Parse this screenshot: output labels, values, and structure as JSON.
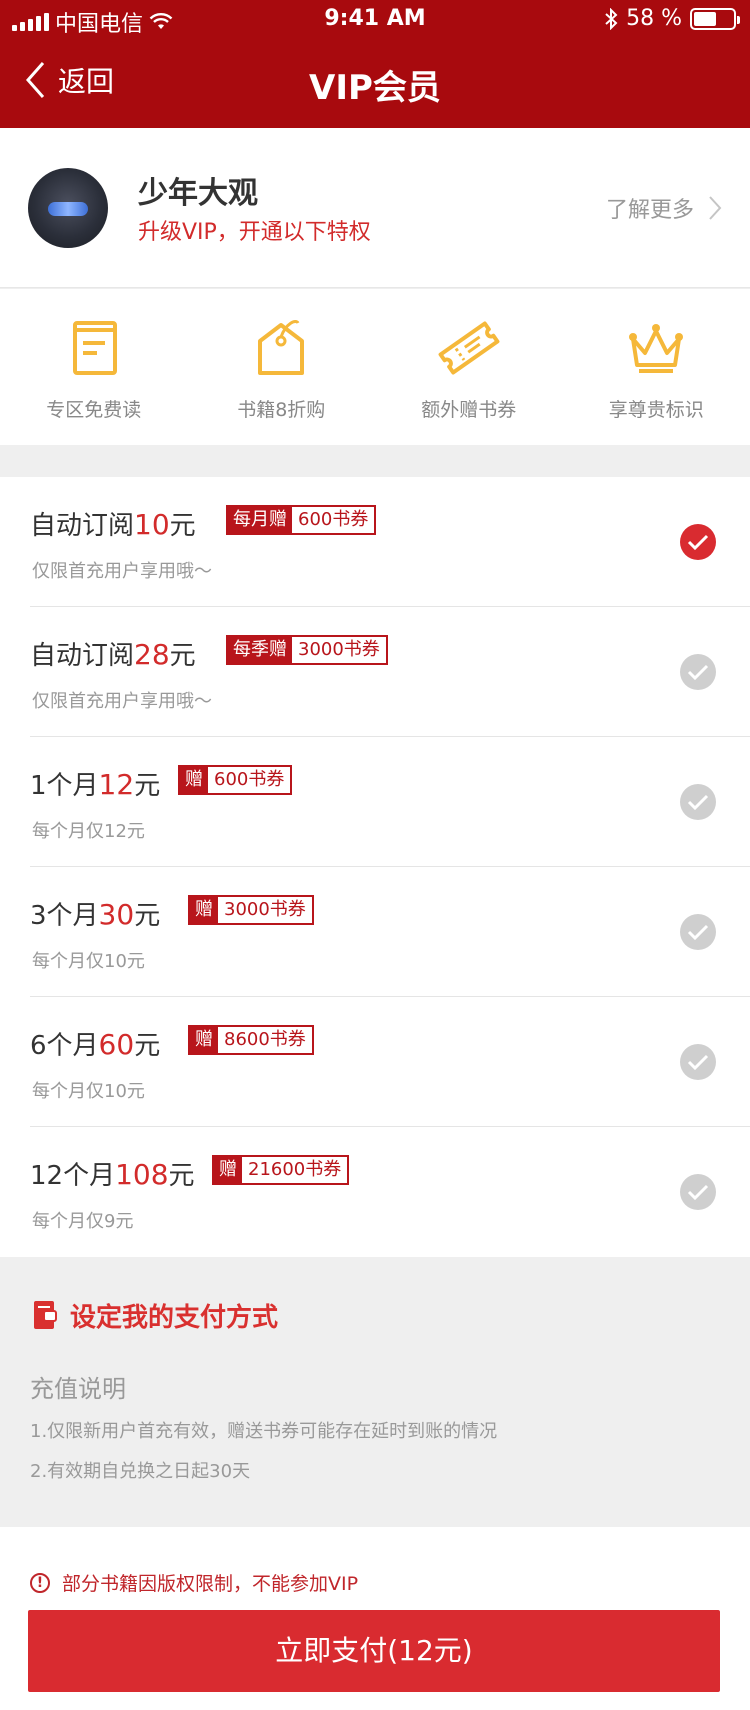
{
  "status_bar": {
    "carrier": "中国电信",
    "time": "9:41 AM",
    "battery_text": "58 %",
    "battery_level": 0.58
  },
  "nav": {
    "back_label": "返回",
    "title": "VIP会员"
  },
  "profile": {
    "name": "少年大观",
    "subtitle": "升级VIP，开通以下特权",
    "learn_more": "了解更多"
  },
  "privileges": [
    {
      "icon": "document-icon",
      "label": "专区免费读"
    },
    {
      "icon": "price-tag-icon",
      "label": "书籍8折购"
    },
    {
      "icon": "ticket-icon",
      "label": "额外赠书券"
    },
    {
      "icon": "crown-icon",
      "label": "享尊贵标识"
    }
  ],
  "plans": [
    {
      "prefix": "自动订阅",
      "price": "10",
      "suffix": "元",
      "tag": "每月赠",
      "amount": "600书券",
      "note": "仅限首充用户享用哦～",
      "selected": true
    },
    {
      "prefix": "自动订阅",
      "price": "28",
      "suffix": "元",
      "tag": "每季赠",
      "amount": "3000书券",
      "note": "仅限首充用户享用哦～",
      "selected": false
    },
    {
      "prefix": "1个月",
      "price": "12",
      "suffix": "元",
      "tag": "赠",
      "amount": "600书券",
      "note": "每个月仅12元",
      "selected": false
    },
    {
      "prefix": "3个月",
      "price": "30",
      "suffix": "元",
      "tag": "赠",
      "amount": "3000书券",
      "note": "每个月仅10元",
      "selected": false
    },
    {
      "prefix": "6个月",
      "price": "60",
      "suffix": "元",
      "tag": "赠",
      "amount": "8600书券",
      "note": "每个月仅10元",
      "selected": false
    },
    {
      "prefix": "12个月",
      "price": "108",
      "suffix": "元",
      "tag": "赠",
      "amount": "21600书券",
      "note": "每个月仅9元",
      "selected": false
    }
  ],
  "payment": {
    "method_label": "设定我的支付方式",
    "explain_title": "充值说明",
    "explain_lines": [
      "1.仅限新用户首充有效，赠送书券可能存在延时到账的情况",
      "2.有效期自兑换之日起30天"
    ]
  },
  "footer": {
    "notice": "部分书籍因版权限制，不能参加VIP",
    "pay_button": "立即支付(12元)"
  },
  "colors": {
    "header": "#a80a0e",
    "accent": "#d92b30",
    "privilege_icon": "#f5b83a"
  }
}
